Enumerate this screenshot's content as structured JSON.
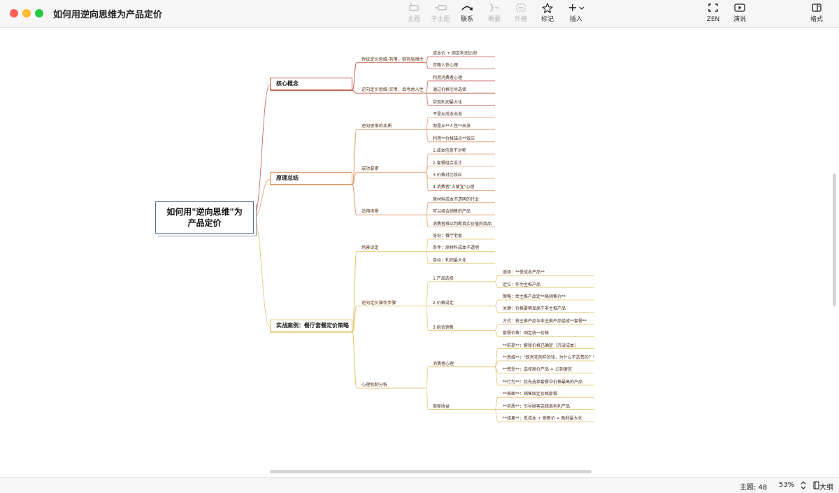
{
  "window": {
    "title": "如何用逆向思维为产品定价",
    "traffic_colors": [
      "#fe5f57",
      "#febc2e",
      "#28c840"
    ]
  },
  "toolbar": {
    "topic": {
      "label": "主题",
      "icon": "topic-icon",
      "enabled": false
    },
    "subtopic": {
      "label": "子主题",
      "icon": "subtopic-icon",
      "enabled": false
    },
    "relationship": {
      "label": "联系",
      "icon": "relationship-arrow-icon",
      "enabled": true
    },
    "summary": {
      "label": "概要",
      "icon": "summary-brace-icon",
      "enabled": false
    },
    "boundary": {
      "label": "外框",
      "icon": "boundary-icon",
      "enabled": false
    },
    "marker": {
      "label": "标记",
      "icon": "star-icon",
      "enabled": true
    },
    "insert": {
      "label": "插入",
      "icon": "plus-icon",
      "enabled": true
    },
    "zen": {
      "label": "ZEN",
      "icon": "fullscreen-icon"
    },
    "present": {
      "label": "演说",
      "icon": "play-icon"
    },
    "format": {
      "label": "格式",
      "icon": "sidebar-panel-icon"
    }
  },
  "mindmap": {
    "root": "如何用\"逆向思维\"为产品定价",
    "branches": [
      {
        "label": "核心概念",
        "color": "#c25a4a",
        "children": [
          {
            "label": "传统定价思维-有用，但有局限性",
            "children": [
              {
                "label": "成本价 + 固定利润比例"
              },
              {
                "label": "忽略人性心理"
              }
            ]
          },
          {
            "label": "逆向定价思维-实用，且考虑人性",
            "children": [
              {
                "label": "利用消费者心理"
              },
              {
                "label": "通过价格引导选择"
              },
              {
                "label": "实现利润最大化"
              }
            ]
          }
        ]
      },
      {
        "label": "原理总结",
        "color": "#e09a6a",
        "children": [
          {
            "label": "逆向思维的本质",
            "children": [
              {
                "label": "不是从成本出发"
              },
              {
                "label": "而是从**人性**出发"
              },
              {
                "label": "利用**价格锚点**效应"
              }
            ]
          },
          {
            "label": "成功要素",
            "children": [
              {
                "label": "1.成本信息不对称"
              },
              {
                "label": "2.套餐组合设计"
              },
              {
                "label": "3.价格对比效应"
              },
              {
                "label": "4.消费者\"占便宜\"心理"
              }
            ]
          },
          {
            "label": "适用场景",
            "children": [
              {
                "label": "原材料成本不透明的行业"
              },
              {
                "label": "可以组合销售的产品"
              },
              {
                "label": "消费者难以判断真实价值的商品"
              }
            ]
          }
        ]
      },
      {
        "label": "实战案例：餐厅套餐定价策略",
        "color": "#e6c06a",
        "children": [
          {
            "label": "场景设定",
            "children": [
              {
                "label": "身份：餐厅老板"
              },
              {
                "label": "条件：原材料成本不透明"
              },
              {
                "label": "目标：利润最大化"
              }
            ]
          },
          {
            "label": "逆向定价操作步骤",
            "children": [
              {
                "label": "1.产品选择",
                "children": [
                  {
                    "label": "选择：**低成本产品**"
                  },
                  {
                    "label": "定位：作为主推产品"
                  }
                ]
              },
              {
                "label": "2.价格设定",
                "children": [
                  {
                    "label": "策略：给主推产品定**高销售价**"
                  },
                  {
                    "label": "关键：价格要明显高于非主推产品"
                  }
                ]
              },
              {
                "label": "3.组合销售",
                "children": [
                  {
                    "label": "方式：将主推产品与非主推产品组成**套餐**"
                  },
                  {
                    "label": "套餐价格：固定统一价格"
                  }
                ]
              }
            ]
          },
          {
            "label": "心理机制分析",
            "children": [
              {
                "label": "消费者心理",
                "children": [
                  {
                    "label": "**前提**：套餐价格已确定（沉没成本）"
                  },
                  {
                    "label": "**思维**：\"既然花同样的钱，为什么不选贵的？\""
                  },
                  {
                    "label": "**感受**：选择高价产品 = 占到便宜"
                  },
                  {
                    "label": "**行为**：优先选择套餐中价格最高的产品"
                  }
                ]
              },
              {
                "label": "商家收益",
                "children": [
                  {
                    "label": "**表面**：销售固定价格套餐"
                  },
                  {
                    "label": "**实质**：引导顾客选择高毛利产品"
                  },
                  {
                    "label": "**结果**：低成本 + 高售价 = 盈利最大化"
                  }
                ]
              }
            ]
          }
        ]
      }
    ]
  },
  "statusbar": {
    "topic_count_label": "主题: 48",
    "zoom": "53%",
    "zoom_icon": "stepper-icon",
    "outline_icon": "book-icon",
    "outline_label": "大纲"
  }
}
